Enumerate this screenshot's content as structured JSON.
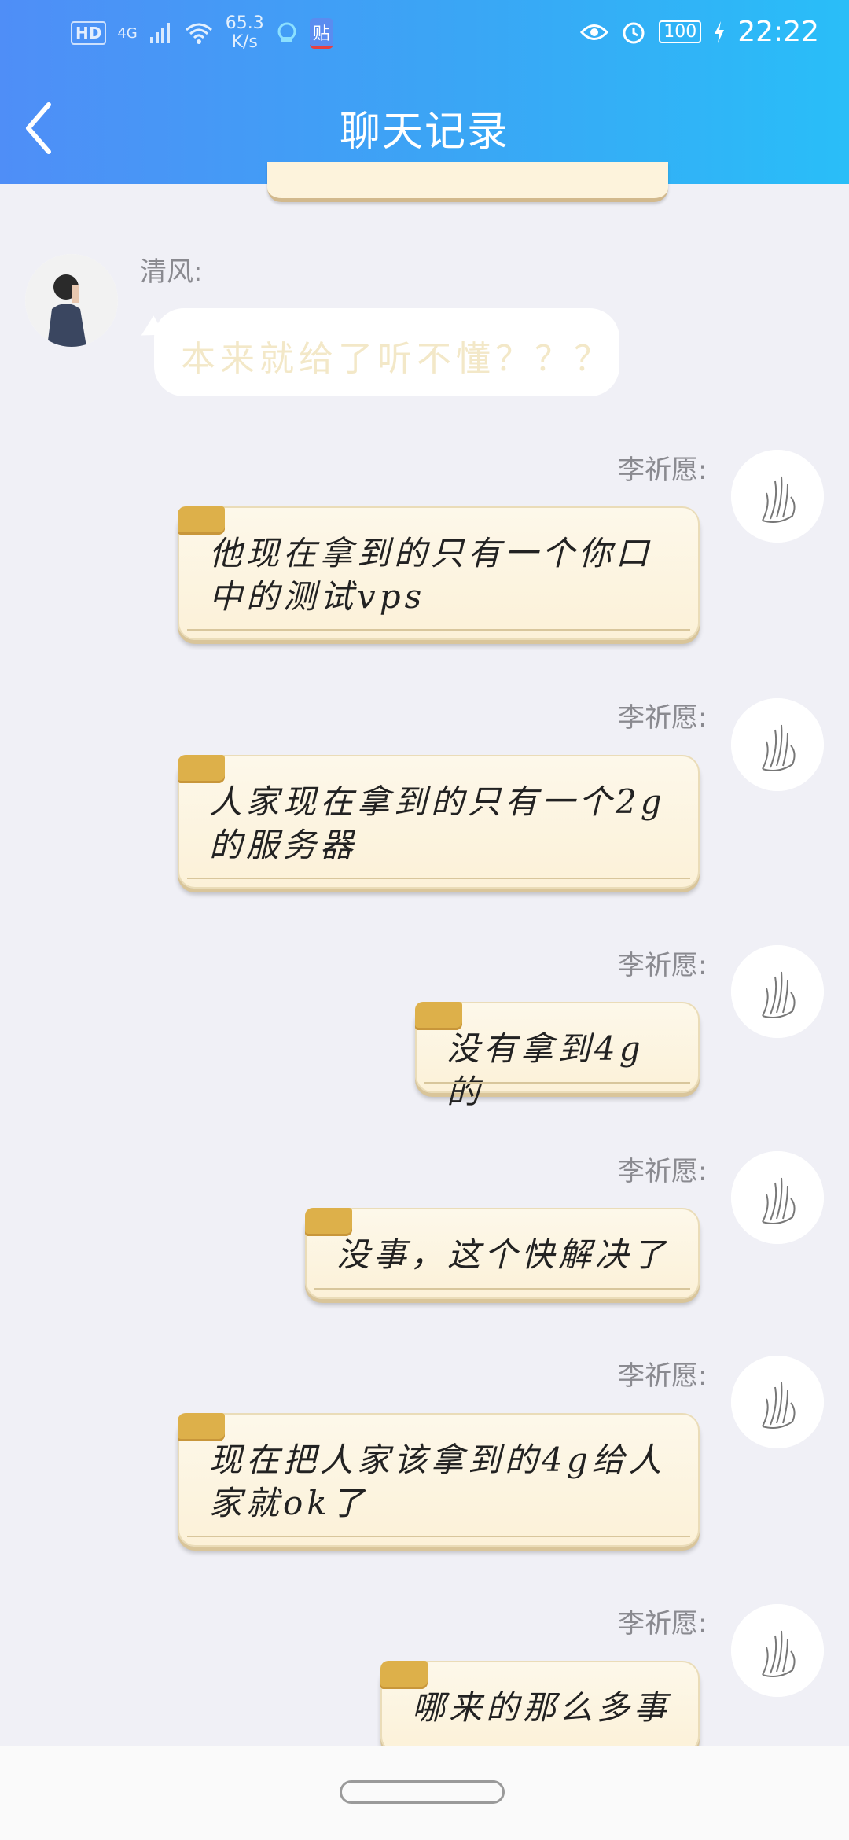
{
  "status_bar": {
    "hd": "HD",
    "network": "4G",
    "speed_value": "65.3",
    "speed_unit": "K/s",
    "app_badge": "贴",
    "battery": "100",
    "time": "22:22",
    "icons": [
      "signal-icon",
      "wifi-icon",
      "app-icon",
      "eye-icon",
      "alarm-icon",
      "charging-icon"
    ]
  },
  "header": {
    "title": "聊天记录",
    "back_icon": "chevron-left-icon"
  },
  "messages": [
    {
      "sender": "清风:",
      "side": "left",
      "text": "本来就给了听不懂？？？"
    },
    {
      "sender": "李祈愿:",
      "side": "right",
      "text": "他现在拿到的只有一个你口中的测试vps"
    },
    {
      "sender": "李祈愿:",
      "side": "right",
      "text": "人家现在拿到的只有一个2g的服务器"
    },
    {
      "sender": "李祈愿:",
      "side": "right",
      "text": "没有拿到4g的"
    },
    {
      "sender": "李祈愿:",
      "side": "right",
      "text": "没事，这个快解决了"
    },
    {
      "sender": "李祈愿:",
      "side": "right",
      "text": "现在把人家该拿到的4g给人家就ok了"
    },
    {
      "sender": "李祈愿:",
      "side": "right",
      "text": "哪来的那么多事"
    }
  ],
  "colors": {
    "header_start": "#4f8ef7",
    "header_end": "#29bef8",
    "background": "#f0f0f6",
    "bubble": "#fdf3dc",
    "bubble_tab": "#ddb04a"
  }
}
